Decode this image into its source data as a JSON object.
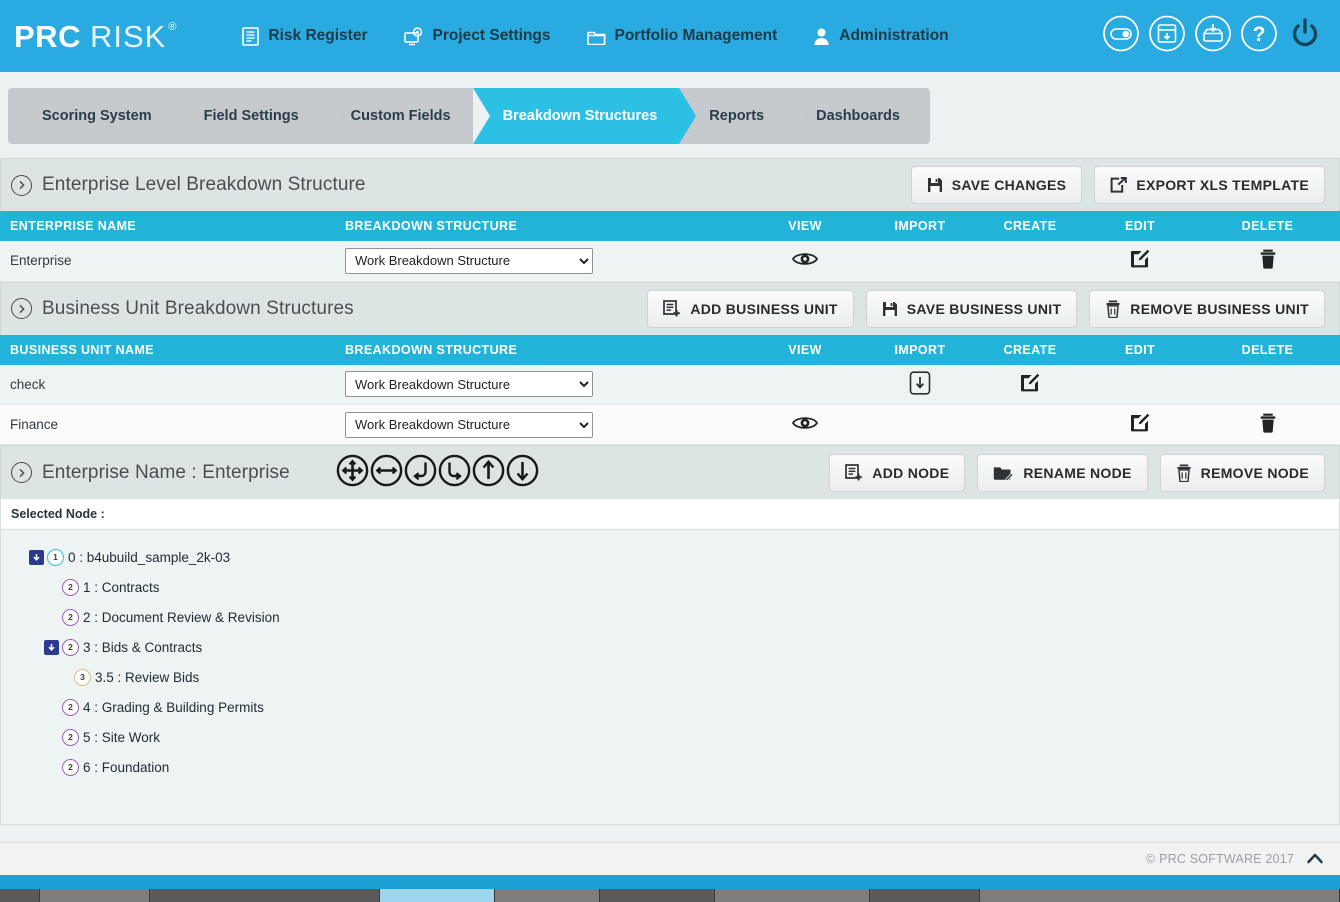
{
  "brand": {
    "name_bold": "PRC",
    "name_light": "RISK",
    "registered": "®"
  },
  "topnav": {
    "items": [
      {
        "label": "Risk Register",
        "icon": "list-document-icon"
      },
      {
        "label": "Project Settings",
        "icon": "gear-screen-icon"
      },
      {
        "label": "Portfolio Management",
        "icon": "folder-icon"
      },
      {
        "label": "Administration",
        "icon": "user-icon"
      }
    ],
    "icons": [
      {
        "name": "toggle-switch-icon"
      },
      {
        "name": "calendar-download-icon"
      },
      {
        "name": "inbox-download-icon"
      },
      {
        "name": "help-question-icon"
      },
      {
        "name": "power-logout-icon"
      }
    ]
  },
  "tabs": [
    {
      "label": "Scoring System",
      "active": false
    },
    {
      "label": "Field Settings",
      "active": false
    },
    {
      "label": "Custom Fields",
      "active": false
    },
    {
      "label": "Breakdown Structures",
      "active": true
    },
    {
      "label": "Reports",
      "active": false
    },
    {
      "label": "Dashboards",
      "active": false
    }
  ],
  "enterprise_panel": {
    "title": "Enterprise Level Breakdown Structure",
    "buttons": [
      {
        "label": "SAVE CHANGES",
        "icon": "floppy-save-icon"
      },
      {
        "label": "EXPORT XLS TEMPLATE",
        "icon": "export-box-icon"
      }
    ],
    "columns": [
      "ENTERPRISE NAME",
      "BREAKDOWN STRUCTURE",
      "VIEW",
      "IMPORT",
      "CREATE",
      "EDIT",
      "DELETE"
    ],
    "rows": [
      {
        "name": "Enterprise",
        "structure": "Work Breakdown Structure",
        "structure_options": [
          "Work Breakdown Structure"
        ],
        "view": true,
        "import": false,
        "create": false,
        "edit": true,
        "delete": true
      }
    ]
  },
  "business_panel": {
    "title": "Business Unit Breakdown Structures",
    "buttons": [
      {
        "label": "ADD BUSINESS UNIT",
        "icon": "add-list-icon"
      },
      {
        "label": "SAVE BUSINESS UNIT",
        "icon": "floppy-save-icon"
      },
      {
        "label": "REMOVE BUSINESS UNIT",
        "icon": "trash-icon"
      }
    ],
    "columns": [
      "BUSINESS UNIT NAME",
      "BREAKDOWN STRUCTURE",
      "VIEW",
      "IMPORT",
      "CREATE",
      "EDIT",
      "DELETE"
    ],
    "rows": [
      {
        "name": "check",
        "structure": "Work Breakdown Structure",
        "structure_options": [
          "Work Breakdown Structure"
        ],
        "view": false,
        "import": true,
        "create": true,
        "edit": false,
        "delete": false
      },
      {
        "name": "Finance",
        "structure": "Work Breakdown Structure",
        "structure_options": [
          "Work Breakdown Structure"
        ],
        "view": true,
        "import": false,
        "create": false,
        "edit": true,
        "delete": true
      }
    ]
  },
  "node_panel": {
    "title": "Enterprise Name : Enterprise",
    "tool_icons": [
      {
        "name": "expand-all-icon"
      },
      {
        "name": "collapse-all-icon"
      },
      {
        "name": "outdent-node-icon"
      },
      {
        "name": "indent-node-icon"
      },
      {
        "name": "move-node-up-icon"
      },
      {
        "name": "move-node-down-icon"
      }
    ],
    "buttons": [
      {
        "label": "ADD NODE",
        "icon": "add-list-icon"
      },
      {
        "label": "RENAME NODE",
        "icon": "folder-pencil-icon"
      },
      {
        "label": "REMOVE NODE",
        "icon": "trash-icon"
      }
    ],
    "selected_node_label": "Selected Node :",
    "selected_node_value": ""
  },
  "tree": {
    "nodes": [
      {
        "label": "0 : b4ubuild_sample_2k-03",
        "level": 1,
        "indent": 0,
        "expandable": true,
        "expanded": true
      },
      {
        "label": "1 : Contracts",
        "level": 2,
        "indent": 1,
        "expandable": false,
        "expanded": false
      },
      {
        "label": "2 : Document Review & Revision",
        "level": 2,
        "indent": 1,
        "expandable": false,
        "expanded": false
      },
      {
        "label": "3 : Bids & Contracts",
        "level": 2,
        "indent": 1,
        "expandable": true,
        "expanded": true
      },
      {
        "label": "3.5 : Review Bids",
        "level": 3,
        "indent": 2,
        "expandable": false,
        "expanded": false
      },
      {
        "label": "4 : Grading & Building Permits",
        "level": 2,
        "indent": 1,
        "expandable": false,
        "expanded": false
      },
      {
        "label": "5 : Site Work",
        "level": 2,
        "indent": 1,
        "expandable": false,
        "expanded": false
      },
      {
        "label": "6 : Foundation",
        "level": 2,
        "indent": 1,
        "expandable": false,
        "expanded": false
      }
    ]
  },
  "footer": {
    "copyright": "© PRC SOFTWARE 2017",
    "scroll_top_icon": "chevron-up-icon"
  },
  "colors": {
    "brand_blue": "#29abe2",
    "table_header": "#22b4d8",
    "tab_active": "#2cc0e4",
    "tab_inactive": "#c6cace",
    "panel_head": "#dde5e4",
    "level1": "#29c3e8",
    "level2": "#9a5fb5",
    "level3": "#d9bd7e",
    "toggle": "#2b3a8f"
  }
}
